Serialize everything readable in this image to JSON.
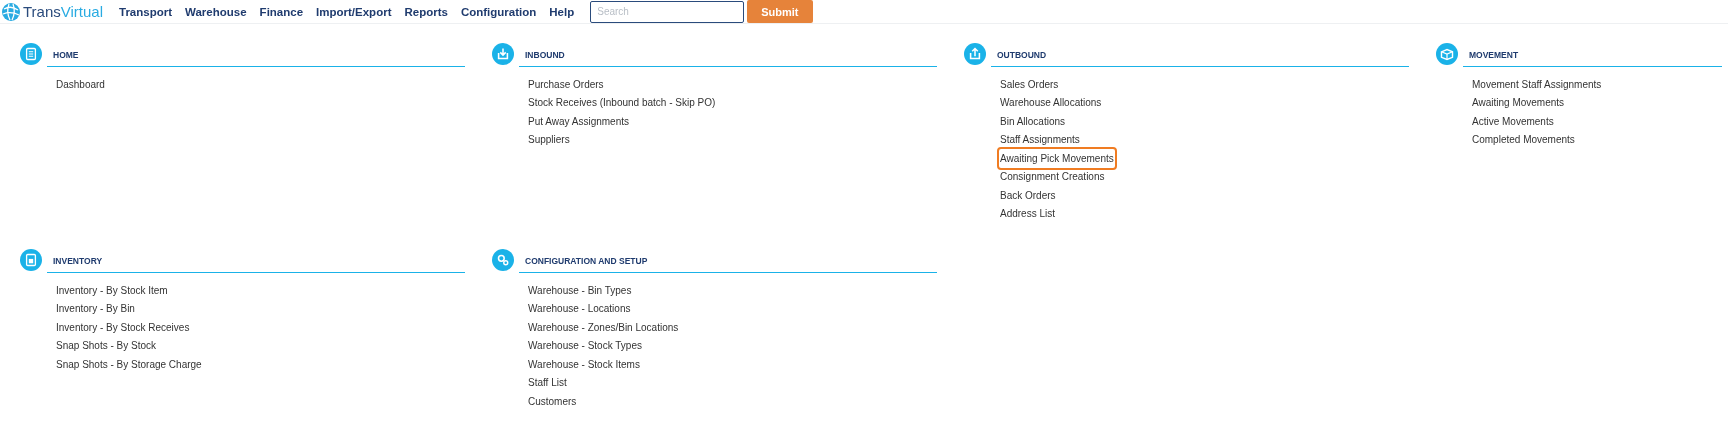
{
  "brand": {
    "part_1": "Trans",
    "part_2": "Virtual"
  },
  "nav": [
    "Transport",
    "Warehouse",
    "Finance",
    "Import/Export",
    "Reports",
    "Configuration",
    "Help"
  ],
  "search": {
    "placeholder": "Search"
  },
  "submit": "Submit",
  "sections": [
    {
      "kind": "home",
      "title": "HOME",
      "items": [
        {
          "label": "Dashboard",
          "highlighted": false
        }
      ]
    },
    {
      "kind": "inbound",
      "title": "INBOUND",
      "items": [
        {
          "label": "Purchase Orders",
          "highlighted": false
        },
        {
          "label": "Stock Receives (Inbound batch - Skip PO)",
          "highlighted": false
        },
        {
          "label": "Put Away Assignments",
          "highlighted": false
        },
        {
          "label": "Suppliers",
          "highlighted": false
        }
      ]
    },
    {
      "kind": "outbound",
      "title": "OUTBOUND",
      "items": [
        {
          "label": "Sales Orders",
          "highlighted": false
        },
        {
          "label": "Warehouse Allocations",
          "highlighted": false
        },
        {
          "label": "Bin Allocations",
          "highlighted": false
        },
        {
          "label": "Staff Assignments",
          "highlighted": false
        },
        {
          "label": "Awaiting Pick Movements",
          "highlighted": true
        },
        {
          "label": "Consignment Creations",
          "highlighted": false
        },
        {
          "label": "Back Orders",
          "highlighted": false
        },
        {
          "label": "Address List",
          "highlighted": false
        }
      ]
    },
    {
      "kind": "movement",
      "title": "MOVEMENT",
      "items": [
        {
          "label": "Movement Staff Assignments",
          "highlighted": false
        },
        {
          "label": "Awaiting Movements",
          "highlighted": false
        },
        {
          "label": "Active Movements",
          "highlighted": false
        },
        {
          "label": "Completed Movements",
          "highlighted": false
        }
      ]
    },
    {
      "kind": "inventory",
      "title": "INVENTORY",
      "items": [
        {
          "label": "Inventory - By Stock Item",
          "highlighted": false
        },
        {
          "label": "Inventory - By Bin",
          "highlighted": false
        },
        {
          "label": "Inventory - By Stock Receives",
          "highlighted": false
        },
        {
          "label": "Snap Shots - By Stock",
          "highlighted": false
        },
        {
          "label": "Snap Shots - By Storage Charge",
          "highlighted": false
        }
      ]
    },
    {
      "kind": "config",
      "title": "CONFIGURATION AND SETUP",
      "items": [
        {
          "label": "Warehouse - Bin Types",
          "highlighted": false
        },
        {
          "label": "Warehouse - Locations",
          "highlighted": false
        },
        {
          "label": "Warehouse - Zones/Bin Locations",
          "highlighted": false
        },
        {
          "label": "Warehouse - Stock Types",
          "highlighted": false
        },
        {
          "label": "Warehouse - Stock Items",
          "highlighted": false
        },
        {
          "label": "Staff List",
          "highlighted": false
        },
        {
          "label": "Customers",
          "highlighted": false
        }
      ]
    }
  ]
}
